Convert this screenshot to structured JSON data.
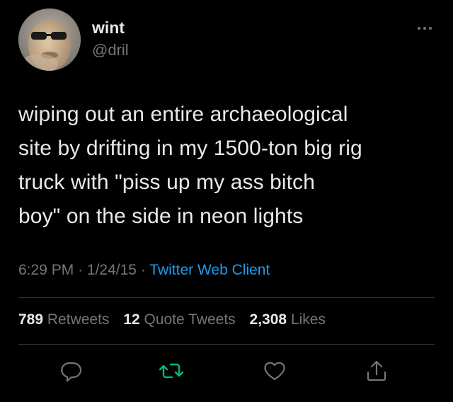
{
  "user": {
    "display_name": "wint",
    "handle": "@dril"
  },
  "tweet": {
    "text": "wiping out an entire archaeological\nsite by drifting in my 1500-ton big rig\ntruck with \"piss up my ass bitch\nboy\" on the side in neon lights",
    "time": "6:29 PM",
    "separator": "·",
    "date": "1/24/15",
    "client": "Twitter Web Client"
  },
  "stats": {
    "retweets_count": "789",
    "retweets_label": "Retweets",
    "quotes_count": "12",
    "quotes_label": "Quote Tweets",
    "likes_count": "2,308",
    "likes_label": "Likes"
  },
  "icons": {
    "more": "more-horizontal-icon",
    "reply": "reply-icon",
    "retweet": "retweet-icon",
    "like": "heart-icon",
    "share": "share-icon"
  },
  "colors": {
    "background": "#000000",
    "text": "#e7e9ea",
    "secondary": "#71767b",
    "link": "#1d9bf0",
    "retweet": "#00ba7c"
  }
}
